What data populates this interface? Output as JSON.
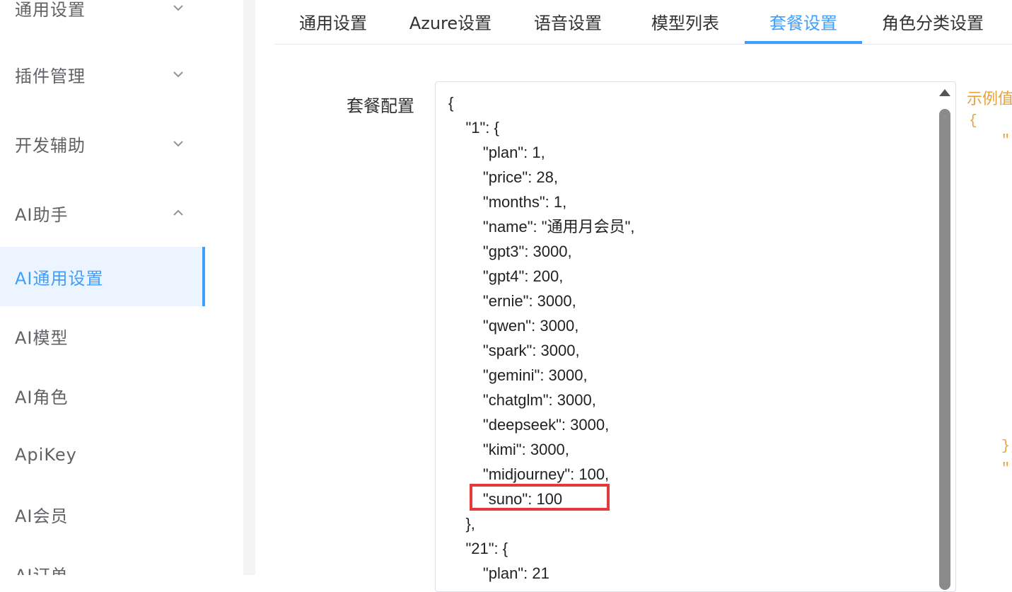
{
  "sidebar": {
    "items": [
      {
        "label": "通用设置",
        "chevron": "down"
      },
      {
        "label": "插件管理",
        "chevron": "down"
      },
      {
        "label": "开发辅助",
        "chevron": "down"
      },
      {
        "label": "AI助手",
        "chevron": "up"
      },
      {
        "label": "AI通用设置",
        "active": true
      },
      {
        "label": "AI模型"
      },
      {
        "label": "AI角色"
      },
      {
        "label": "ApiKey"
      },
      {
        "label": "AI会员"
      },
      {
        "label": "AI订单"
      }
    ]
  },
  "tabs": [
    {
      "label": "通用设置"
    },
    {
      "label": "Azure设置"
    },
    {
      "label": "语音设置"
    },
    {
      "label": "模型列表"
    },
    {
      "label": "套餐设置",
      "active": true
    },
    {
      "label": "角色分类设置"
    }
  ],
  "form": {
    "label": "套餐配置",
    "code_lines": [
      "{",
      "    \"1\": {",
      "        \"plan\": 1,",
      "        \"price\": 28,",
      "        \"months\": 1,",
      "        \"name\": \"通用月会员\",",
      "        \"gpt3\": 3000,",
      "        \"gpt4\": 200,",
      "        \"ernie\": 3000,",
      "        \"qwen\": 3000,",
      "        \"spark\": 3000,",
      "        \"gemini\": 3000,",
      "        \"chatglm\": 3000,",
      "        \"deepseek\": 3000,",
      "        \"kimi\": 3000,",
      "        \"midjourney\": 100,",
      "        \"suno\": 100",
      "    },",
      "    \"21\": {",
      "        \"plan\": 21"
    ],
    "highlighted_line": "\"suno\": 100"
  },
  "example": {
    "title": "示例值",
    "glyphs": [
      "{",
      "\"",
      "},",
      "\""
    ]
  },
  "colors": {
    "accent": "#409eff",
    "highlight": "#e43a3a",
    "example": "#e6a23c"
  }
}
